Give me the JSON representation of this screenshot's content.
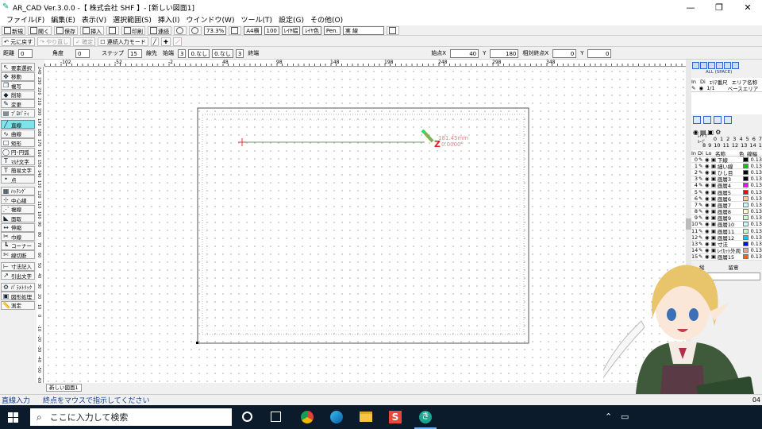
{
  "window": {
    "title": "AR_CAD Ver.3.0.0 -【 株式会社 SHF 】- [新しい図面1]",
    "min": "—",
    "max": "❐",
    "close": "✕"
  },
  "menu": [
    "ファイル(F)",
    "編集(E)",
    "表示(V)",
    "選択範囲(S)",
    "挿入(I)",
    "ウインドウ(W)",
    "ツール(T)",
    "設定(G)",
    "その他(O)"
  ],
  "toolbar1": {
    "new": "新規",
    "open": "開く",
    "save": "保存",
    "insert": "挿入",
    "print": "印刷",
    "continuous": "連続",
    "zoom": "73.3%",
    "paper": "A4横",
    "scale": "100",
    "layer_width": "ﾚｲﾔ幅",
    "layer_color": "ﾚｲﾔ色",
    "pen": "Pen.",
    "line_type": "実 線"
  },
  "toolbar2": {
    "undo": "元に戻す",
    "redo": "やり直し",
    "confirm": "確定",
    "continuous_mode": "連続入力モード"
  },
  "toolbar3": {
    "distance_label": "距離",
    "distance_value": "0",
    "angle_label": "角度",
    "angle_value": "0",
    "step_label": "ステップ",
    "step_value": "15",
    "line_end_label": "線先",
    "line_end_start": "始端",
    "line_end_start_value": "3",
    "line_end_none1": "0.なし",
    "line_end_none2": "0.なし",
    "line_end_end_value": "3",
    "line_end_end": "終端",
    "point_label": "始点X",
    "point_x": "40",
    "point_y_label": "Y",
    "point_y": "180",
    "relative_label": "相対終点X",
    "relative_x": "0",
    "relative_y_label": "Y",
    "relative_y": "0"
  },
  "ruler_top_labels": [
    "-102",
    "-52",
    "-2",
    "48",
    "98",
    "148",
    "198",
    "248",
    "298",
    "348"
  ],
  "ruler_left_labels": [
    "240",
    "230",
    "220",
    "210",
    "200",
    "190",
    "180",
    "170",
    "160",
    "150",
    "140",
    "130",
    "120",
    "110",
    "100",
    "90",
    "80",
    "70",
    "60",
    "50",
    "40",
    "30",
    "20",
    "10",
    "0",
    "-10",
    "-20",
    "-30",
    "-40",
    "-50",
    "-60"
  ],
  "left_tools": [
    {
      "icon": "arrow-icon",
      "glyph": "↖",
      "label": "要素選択",
      "active": false
    },
    {
      "icon": "move-icon",
      "glyph": "✥",
      "label": "移動",
      "active": false
    },
    {
      "icon": "copy-icon",
      "glyph": "❐",
      "label": "複写",
      "active": false
    },
    {
      "icon": "delete-icon",
      "glyph": "◆",
      "label": "削除",
      "active": false
    },
    {
      "icon": "edit-icon",
      "glyph": "✎",
      "label": "変更",
      "active": false
    },
    {
      "icon": "property-icon",
      "glyph": "▤",
      "label": "ﾌﾟﾛﾊﾟﾃｨ",
      "active": false
    },
    {
      "icon": "line-icon",
      "glyph": "╱",
      "label": "直線",
      "active": true
    },
    {
      "icon": "curve-icon",
      "glyph": "∿",
      "label": "曲線",
      "active": false
    },
    {
      "icon": "rect-icon",
      "glyph": "□",
      "label": "矩形",
      "active": false
    },
    {
      "icon": "circle-icon",
      "glyph": "◯",
      "label": "円･円弧",
      "active": false
    },
    {
      "icon": "text-icon",
      "glyph": "T",
      "label": "ﾏﾙﾁ文字",
      "active": false
    },
    {
      "icon": "text-icon",
      "glyph": "T",
      "label": "簡易文字",
      "active": false
    },
    {
      "icon": "point-icon",
      "glyph": "•",
      "label": "点",
      "active": false
    },
    {
      "icon": "hatch-icon",
      "glyph": "▦",
      "label": "ﾊｯﾁﾝｸﾞ",
      "active": false
    },
    {
      "icon": "centerline-icon",
      "glyph": "⊹",
      "label": "中心線",
      "active": false
    },
    {
      "icon": "offset-icon",
      "glyph": "⋰",
      "label": "複線",
      "active": false
    },
    {
      "icon": "chamfer-icon",
      "glyph": "◣",
      "label": "面取",
      "active": false
    },
    {
      "icon": "stretch-icon",
      "glyph": "↔",
      "label": "伸縮",
      "active": false
    },
    {
      "icon": "trim-icon",
      "glyph": "✂",
      "label": "巾線",
      "active": false
    },
    {
      "icon": "corner-icon",
      "glyph": "┗",
      "label": "コーナー",
      "active": false
    },
    {
      "icon": "cut-icon",
      "glyph": "✄",
      "label": "線切断",
      "active": false
    },
    {
      "icon": "dimension-icon",
      "glyph": "⊢",
      "label": "寸法記入",
      "active": false
    },
    {
      "icon": "leader-icon",
      "glyph": "↗",
      "label": "引出文字",
      "active": false
    },
    {
      "icon": "parametric-icon",
      "glyph": "⚙",
      "label": "ﾊﾟﾗﾒﾄﾘｯｸ",
      "active": false
    },
    {
      "icon": "region-icon",
      "glyph": "▣",
      "label": "図形処理",
      "active": false
    },
    {
      "icon": "measure-icon",
      "glyph": "📏",
      "label": "測定",
      "active": false
    }
  ],
  "canvas": {
    "dimension_length": "181.45mm",
    "dimension_angle": "0.0000°",
    "page_label": "新しい図面1"
  },
  "right_panel": {
    "snap_label": "ALL (SPACE)",
    "page_headers": [
      "In",
      "Di",
      "ｴﾘｱ番尺",
      "エリア名称"
    ],
    "page_row": {
      "num": "1/1",
      "name": "ベースエリア"
    },
    "layer_headers": [
      "In",
      "Di",
      "Lo",
      "名称",
      "色",
      "線幅"
    ],
    "numbers_top": [
      "0",
      "1",
      "2",
      "3",
      "4",
      "5",
      "6",
      "7"
    ],
    "numbers_bottom": [
      "8",
      "9",
      "10",
      "11",
      "12",
      "13",
      "14",
      "15"
    ],
    "group_label": "ﾚｲﾔ ｸﾞﾙｰﾌﾟ",
    "layers": [
      {
        "num": "0",
        "name": "下線",
        "color": "#000000",
        "width": "0.13"
      },
      {
        "num": "1",
        "name": "細い線",
        "color": "#00cc00",
        "width": "0.13"
      },
      {
        "num": "2",
        "name": "ひし目",
        "color": "#000000",
        "width": "0.13"
      },
      {
        "num": "3",
        "name": "画層3",
        "color": "#000000",
        "width": "0.13"
      },
      {
        "num": "4",
        "name": "画層4",
        "color": "#ff00ff",
        "width": "0.13"
      },
      {
        "num": "5",
        "name": "画層5",
        "color": "#ff0000",
        "width": "0.13"
      },
      {
        "num": "6",
        "name": "画層6",
        "color": "#ffcc99",
        "width": "0.13"
      },
      {
        "num": "7",
        "name": "画層7",
        "color": "#ccffff",
        "width": "0.13"
      },
      {
        "num": "8",
        "name": "画層8",
        "color": "#ffffcc",
        "width": "0.13"
      },
      {
        "num": "9",
        "name": "画層9",
        "color": "#ccffcc",
        "width": "0.13"
      },
      {
        "num": "10",
        "name": "画層10",
        "color": "#ccffff",
        "width": "0.13"
      },
      {
        "num": "11",
        "name": "画層11",
        "color": "#ccffcc",
        "width": "0.13"
      },
      {
        "num": "12",
        "name": "画層12",
        "color": "#00ccff",
        "width": "0.13"
      },
      {
        "num": "13",
        "name": "寸法",
        "color": "#0000ff",
        "width": "0.13"
      },
      {
        "num": "14",
        "name": "ﾚｲｶｯﾄ外周",
        "color": "#ff9999",
        "width": "0.13"
      },
      {
        "num": "15",
        "name": "画層15",
        "color": "#ff6600",
        "width": "0.13"
      }
    ],
    "footer_left": "縦",
    "footer_right": "留意"
  },
  "status": {
    "mode": "直線入力",
    "message": "終点をマウスで指示してください",
    "right_value": "04"
  },
  "taskbar": {
    "search_placeholder": "ここに入力して検索"
  }
}
